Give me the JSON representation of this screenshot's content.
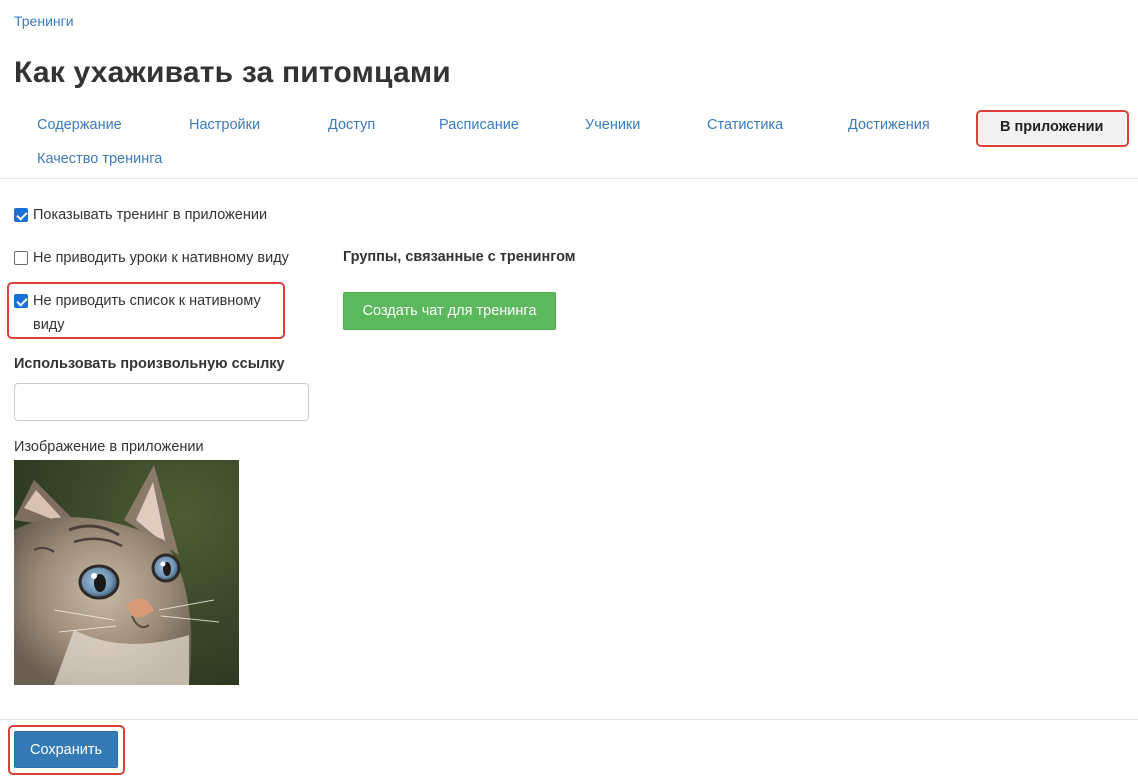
{
  "breadcrumb": "Тренинги",
  "title": "Как ухаживать за питомцами",
  "tabs": [
    {
      "label": "Содержание"
    },
    {
      "label": "Настройки"
    },
    {
      "label": "Доступ"
    },
    {
      "label": "Расписание"
    },
    {
      "label": "Ученики"
    },
    {
      "label": "Статистика"
    },
    {
      "label": "Достижения"
    },
    {
      "label": "В приложении",
      "active": true
    },
    {
      "label": "Качество тренинга"
    }
  ],
  "options": {
    "show_in_app": {
      "label": "Показывать тренинг в приложении",
      "checked": true
    },
    "no_native_lessons": {
      "label": "Не приводить уроки к нативному виду",
      "checked": false
    },
    "no_native_list": {
      "label": "Не приводить список к нативному виду",
      "checked": true
    }
  },
  "custom_link": {
    "label": "Использовать произвольную ссылку",
    "value": "",
    "placeholder": ""
  },
  "app_image": {
    "label": "Изображение в приложении",
    "icon": "cat-photo"
  },
  "groups": {
    "label": "Группы, связанные с тренингом",
    "create_chat_button": "Создать чат для тренинга"
  },
  "save_button": "Сохранить",
  "colors": {
    "link": "#3b7bbf",
    "annotation": "#d9413a",
    "success": "#5cb85c",
    "primary": "#337ab7"
  }
}
